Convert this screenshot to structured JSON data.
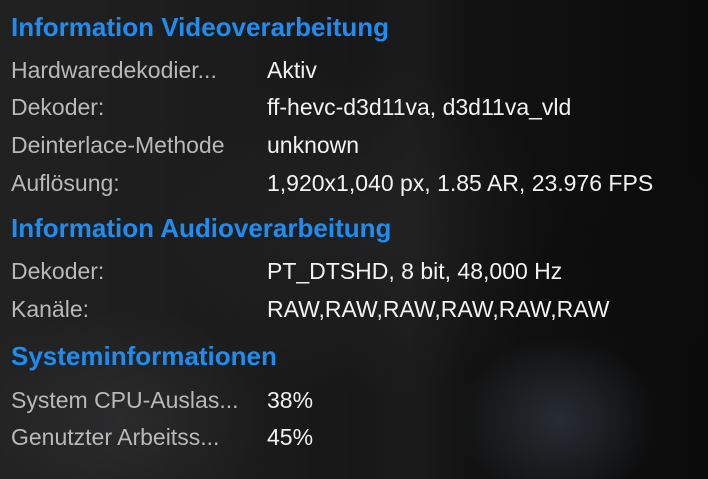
{
  "video": {
    "title": "Information Videoverarbeitung",
    "rows": [
      {
        "label": "Hardwaredekodier...",
        "value": "Aktiv"
      },
      {
        "label": "Dekoder:",
        "value": "ff-hevc-d3d11va, d3d11va_vld"
      },
      {
        "label": "Deinterlace-Methode",
        "value": "unknown"
      },
      {
        "label": "Auflösung:",
        "value": "1,920x1,040 px, 1.85 AR, 23.976 FPS"
      }
    ]
  },
  "audio": {
    "title": "Information Audioverarbeitung",
    "rows": [
      {
        "label": "Dekoder:",
        "value": "PT_DTSHD, 8 bit, 48,000 Hz"
      },
      {
        "label": "Kanäle:",
        "value": "RAW,RAW,RAW,RAW,RAW,RAW"
      }
    ]
  },
  "system": {
    "title": "Systeminformationen",
    "rows": [
      {
        "label": "System CPU-Auslas...",
        "value": "38%"
      },
      {
        "label": "Genutzter Arbeitss...",
        "value": "45%"
      }
    ]
  },
  "colors": {
    "heading": "#1f8cf0",
    "label": "#b9b9b9",
    "value": "#f2f2f2"
  }
}
